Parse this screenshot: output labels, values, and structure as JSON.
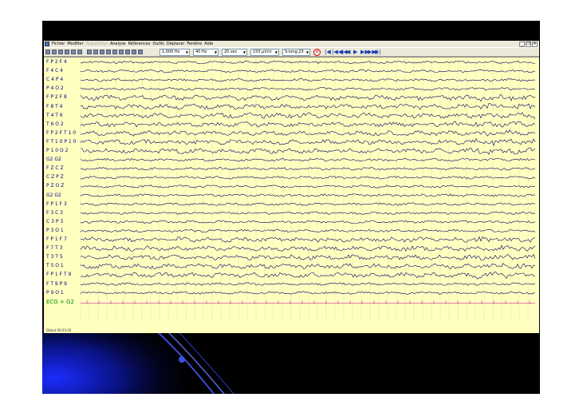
{
  "menu": {
    "items": [
      {
        "label": "Fichier",
        "disabled": false
      },
      {
        "label": "Modifier",
        "disabled": false
      },
      {
        "label": "Acquisition",
        "disabled": true
      },
      {
        "label": "Analyse",
        "disabled": false
      },
      {
        "label": "Références",
        "disabled": false
      },
      {
        "label": "Outils",
        "disabled": false
      },
      {
        "label": "Déplacer",
        "disabled": false
      },
      {
        "label": "Fenêtre",
        "disabled": false
      },
      {
        "label": "Aide",
        "disabled": false
      }
    ],
    "window_controls": [
      "_",
      "❐",
      "✕"
    ]
  },
  "toolbar": {
    "low_filter": "1,000 Hz",
    "high_filter": "40 Hz",
    "timebase": "20 sec",
    "sensitivity": "150 µV/cr",
    "montage": "S-long.23",
    "nav_glyphs": [
      "|◀",
      "|◀◀",
      "◀◀",
      "◀",
      "▶",
      "▶▶",
      "▶▶|",
      "▶|"
    ]
  },
  "channels": [
    "F P 2 F 4",
    "F 4 C 4",
    "C 4 P 4",
    "P 4 O 2",
    "F P 2 F 8",
    "F 8 T 4",
    "T 4 T 6",
    "T 6 O 2",
    "F P 2 F T 1 0",
    "F T 1 0 P 1 0",
    "P 1 0 O 2",
    "G2 G2",
    "F Z C Z",
    "C Z P Z",
    "P Z O Z",
    "G2 G2",
    "F P 1 F 3",
    "F 3 C 3",
    "C 3 P 3",
    "P 3 O 1",
    "F P 1 F 7",
    "F 7 T 3",
    "T 3 T 5",
    "T 5 O 1",
    "F P 1 F T 9",
    "F T 9 P 9",
    "P 9 O 1"
  ],
  "ecg_label": "ECG + G2",
  "status_text": "Début 00:03:00",
  "colors": {
    "trace": "#000066",
    "panel_bg": "#ffffc0",
    "label": "#00008a",
    "ecg": "#009000",
    "ecg_marks": "#cc3399"
  }
}
